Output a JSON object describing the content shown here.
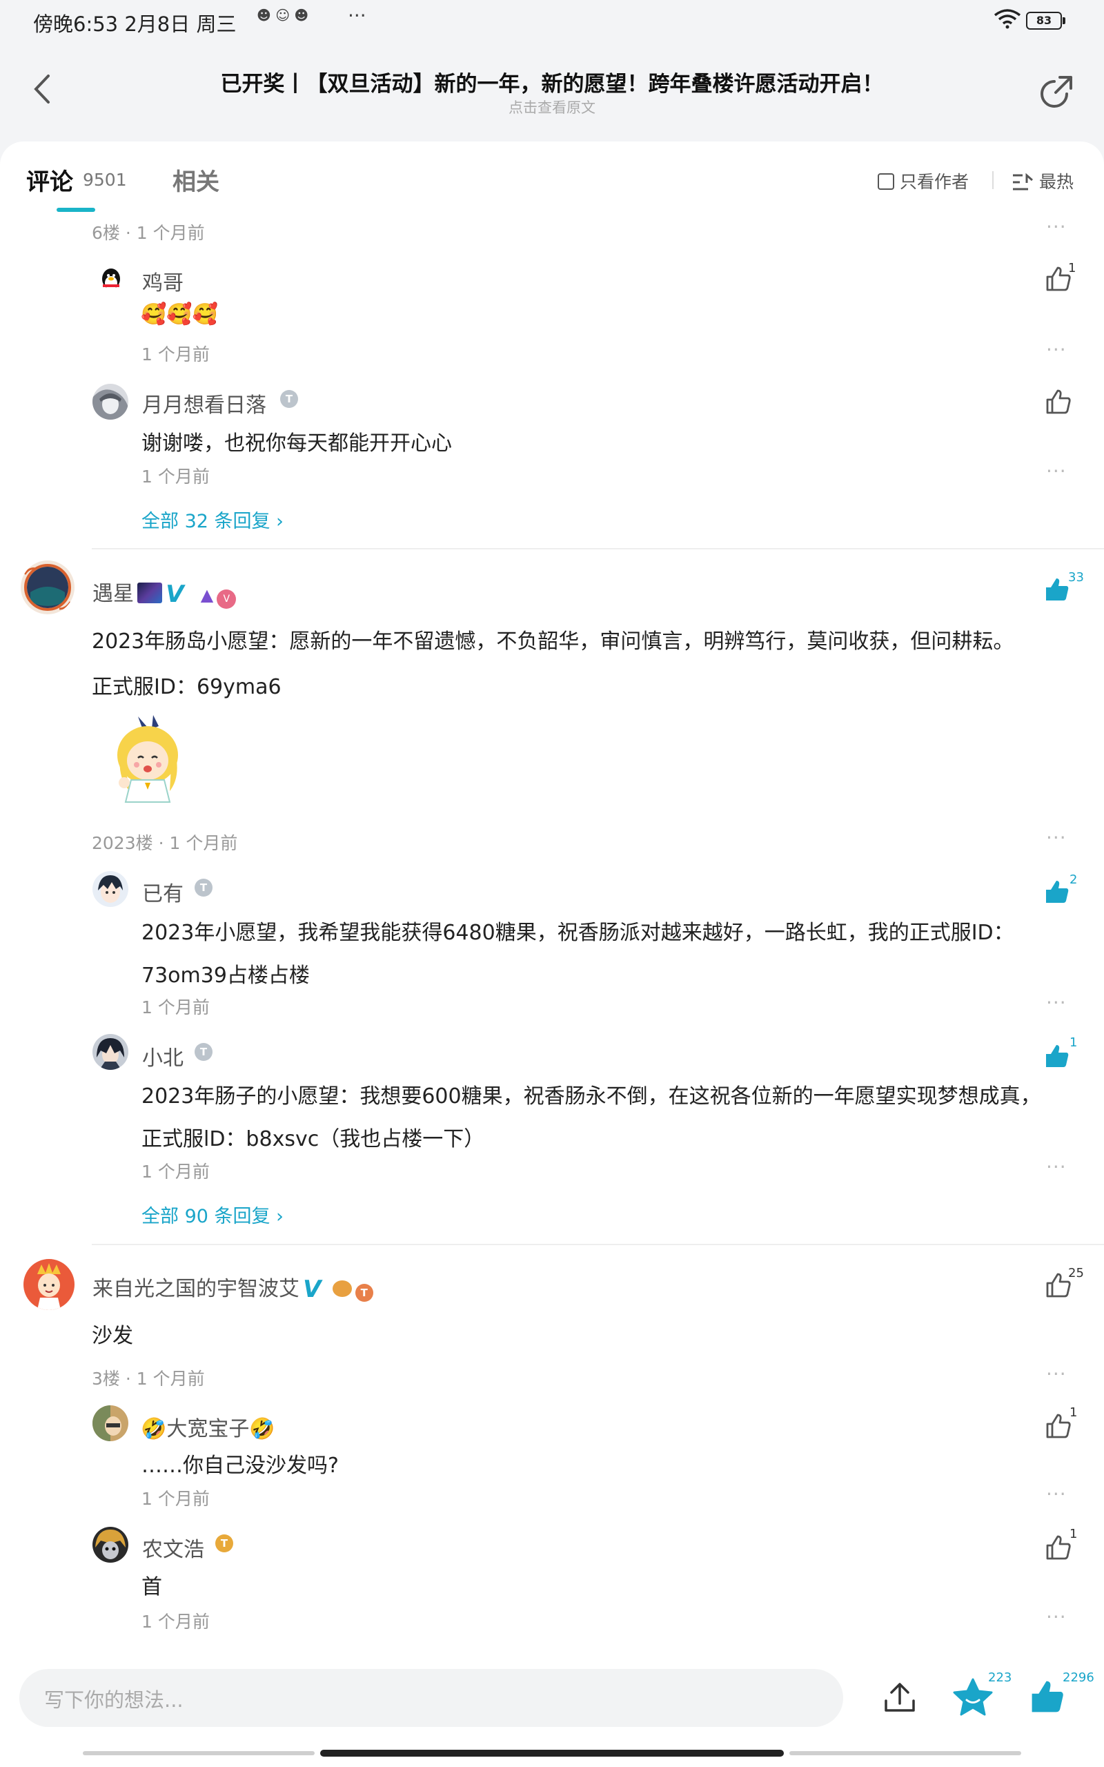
{
  "status_bar": {
    "time": "傍晚6:53  2月8日 周三",
    "more": "···",
    "battery": "83"
  },
  "header": {
    "title": "已开奖丨【双旦活动】新的一年，新的愿望！跨年叠楼许愿活动开启！",
    "subtitle": "点击查看原文"
  },
  "tabs": {
    "comments": "评论",
    "comments_count": "9501",
    "related": "相关",
    "only_author": "只看作者",
    "sort": "最热"
  },
  "thread1": {
    "floor_meta": "6楼 · 1 个月前",
    "replies": [
      {
        "name": "鸡哥",
        "text": "🥰🥰🥰",
        "time": "1 个月前",
        "likes": "1"
      },
      {
        "name": "月月想看日落",
        "text": "谢谢喽，也祝你每天都能开开心心",
        "time": "1 个月前",
        "likes": ""
      }
    ],
    "all_replies": "全部 32 条回复 ›"
  },
  "thread2": {
    "name": "遇星",
    "likes": "33",
    "text1": "2023年肠岛小愿望：愿新的一年不留遗憾，不负韶华，审问慎言，明辨笃行，莫问收获，但问耕耘。",
    "text2": "正式服ID：69yma6",
    "floor_meta": "2023楼  · 1 个月前",
    "replies": [
      {
        "name": "已有",
        "text1": "2023年小愿望，我希望我能获得6480糖果，祝香肠派对越来越好，一路长虹，我的正式服ID：",
        "text2": "73om39占楼占楼",
        "time": "1 个月前",
        "likes": "2"
      },
      {
        "name": "小北",
        "text1": "2023年肠子的小愿望：我想要600糖果，祝香肠永不倒，在这祝各位新的一年愿望实现梦想成真，",
        "text2": "正式服lD：b8xsvc（我也占楼一下）",
        "time": "1 个月前",
        "likes": "1"
      }
    ],
    "all_replies": "全部 90 条回复 ›"
  },
  "thread3": {
    "name": "来自光之国的宇智波艾",
    "likes": "25",
    "text": "沙发",
    "floor_meta": "3楼  · 1 个月前",
    "replies": [
      {
        "name": "🤣大宽宝子🤣",
        "text": "……你自己没沙发吗?",
        "time": "1 个月前",
        "likes": "1"
      },
      {
        "name": "农文浩",
        "text": "首",
        "time": "1 个月前",
        "likes": "1"
      }
    ]
  },
  "bottom": {
    "placeholder": "写下你的想法...",
    "star_count": "223",
    "like_count": "2296"
  },
  "colors": {
    "accent": "#1aa5c9",
    "background": "#f3f4f6",
    "card": "#ffffff"
  },
  "icons": [
    "back-arrow-icon",
    "share-icon",
    "checkbox-icon",
    "sort-icon",
    "more-icon",
    "thumb-up-icon",
    "upload-icon",
    "star-icon"
  ]
}
